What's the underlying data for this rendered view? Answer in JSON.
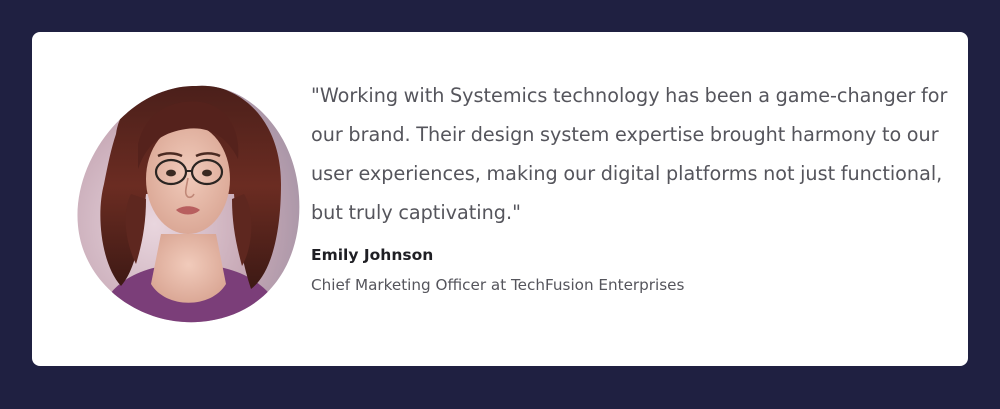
{
  "testimonial": {
    "quote": "\"Working with Systemics technology has been a game-changer for our brand. Their design system expertise brought harmony to our user experiences, making our digital platforms not just functional, but truly captivating.\"",
    "author_name": "Emily Johnson",
    "author_role": "Chief Marketing Officer at TechFusion Enterprises"
  },
  "colors": {
    "page_background": "#1f2041",
    "card_background": "#ffffff",
    "quote_text": "#55555c",
    "name_text": "#1f1f24"
  },
  "icons": {
    "avatar": "person-portrait-photo"
  }
}
